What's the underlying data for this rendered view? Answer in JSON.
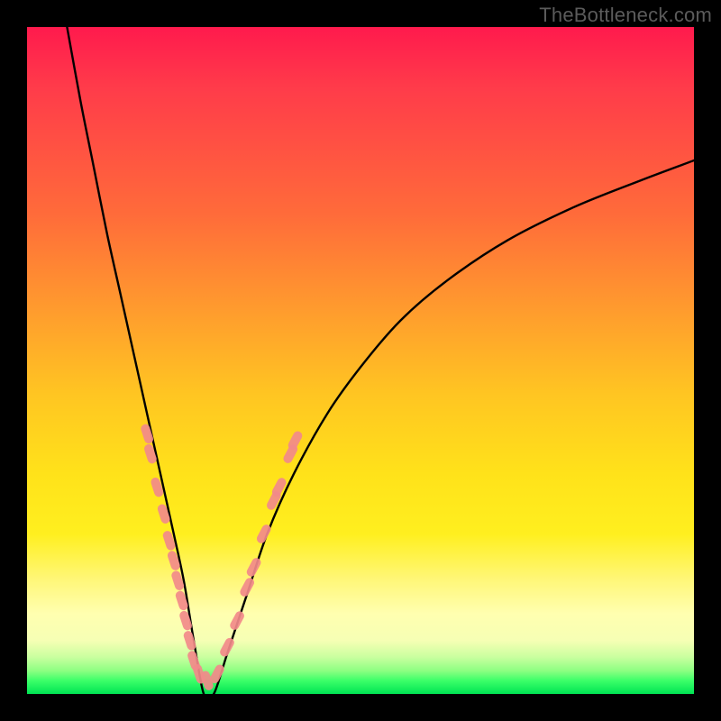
{
  "watermark": {
    "text": "TheBottleneck.com"
  },
  "chart_data": {
    "type": "line",
    "title": "",
    "xlabel": "",
    "ylabel": "",
    "xlim": [
      0,
      100
    ],
    "ylim": [
      0,
      100
    ],
    "series": [
      {
        "name": "bottleneck-curve",
        "x": [
          6,
          8,
          10,
          12,
          14,
          16,
          18,
          20,
          22,
          23.5,
          25,
          26.5,
          28,
          30,
          33,
          36,
          40,
          45,
          50,
          56,
          63,
          72,
          82,
          92,
          100
        ],
        "y": [
          100,
          89,
          79,
          69,
          60,
          51,
          42,
          33,
          24,
          17,
          8,
          0,
          0,
          6,
          15,
          24,
          33,
          42,
          49,
          56,
          62,
          68,
          73,
          77,
          80
        ]
      }
    ],
    "markers": {
      "name": "pink-beads",
      "color": "#f28a8a",
      "points_left": [
        {
          "x": 18.0,
          "y": 39
        },
        {
          "x": 18.5,
          "y": 36
        },
        {
          "x": 19.5,
          "y": 31
        },
        {
          "x": 20.5,
          "y": 27
        },
        {
          "x": 21.3,
          "y": 23
        },
        {
          "x": 22.0,
          "y": 20
        },
        {
          "x": 22.6,
          "y": 17
        },
        {
          "x": 23.2,
          "y": 14
        },
        {
          "x": 23.8,
          "y": 11
        },
        {
          "x": 24.4,
          "y": 8
        },
        {
          "x": 25.0,
          "y": 5
        },
        {
          "x": 25.8,
          "y": 3
        },
        {
          "x": 27.0,
          "y": 2
        }
      ],
      "points_right": [
        {
          "x": 28.5,
          "y": 3
        },
        {
          "x": 30.0,
          "y": 7
        },
        {
          "x": 31.5,
          "y": 11
        },
        {
          "x": 33.0,
          "y": 16
        },
        {
          "x": 34.0,
          "y": 19
        },
        {
          "x": 35.5,
          "y": 24
        },
        {
          "x": 37.0,
          "y": 29
        },
        {
          "x": 37.8,
          "y": 31
        },
        {
          "x": 39.5,
          "y": 36
        },
        {
          "x": 40.2,
          "y": 38
        }
      ]
    }
  }
}
